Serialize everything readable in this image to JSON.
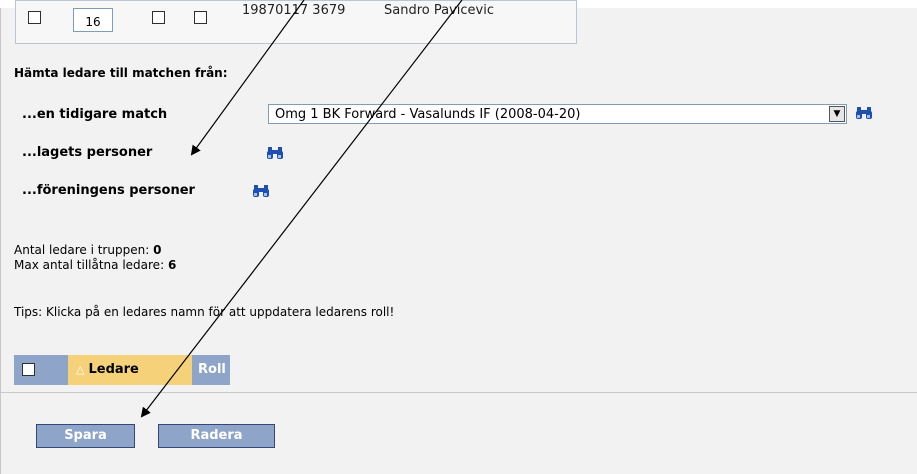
{
  "top_row": {
    "number": "16",
    "id_number": "19870117 3679",
    "name": "Sandro Pavicevic"
  },
  "fetch": {
    "title": "Hämta ledare till matchen från:",
    "prev_match_label": "...en tidigare match",
    "prev_match_selected": "Omg 1 BK Forward - Vasalunds IF (2008-04-20)",
    "team_persons_label": "...lagets personer",
    "club_persons_label": "...föreningens personer"
  },
  "stats": {
    "count_label": "Antal ledare i truppen:",
    "count_value": "0",
    "max_label": "Max antal tillåtna ledare:",
    "max_value": "6"
  },
  "tips": "Tips: Klicka på en ledares namn för att uppdatera ledarens roll!",
  "table_header": {
    "ledare": "Ledare",
    "roll": "Roll"
  },
  "buttons": {
    "save": "Spara",
    "delete": "Radera"
  },
  "icons": {
    "binoculars": "binoculars-icon",
    "dropdown": "chevron-down-icon"
  },
  "colors": {
    "header_blue": "#8ea4c8",
    "header_yellow": "#f5d27a",
    "icon_blue": "#1f4fb0"
  }
}
